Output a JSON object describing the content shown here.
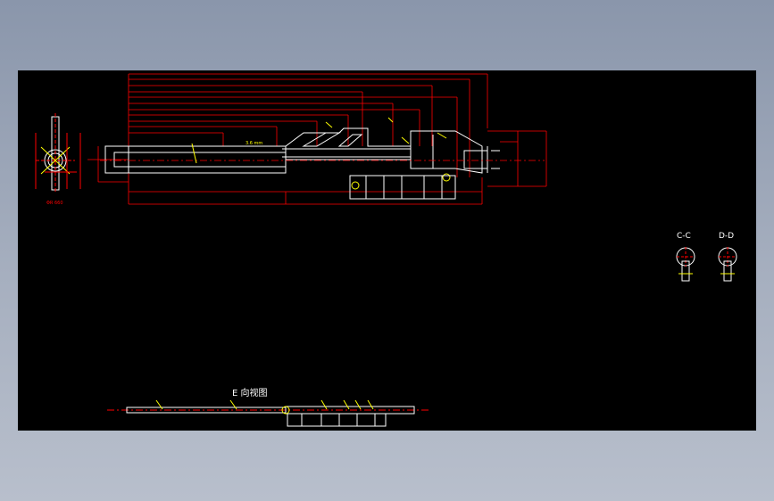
{
  "drawing": {
    "main_dimension": "3.6 mm",
    "section_c": "C-C",
    "section_d": "D-D",
    "view_e": "E 向视图",
    "left_ref": "ΦR 660"
  },
  "colors": {
    "background": "#000000",
    "outline": "#ffffff",
    "dimension": "#ff0000",
    "annotation": "#ffff00",
    "frame": "#8a96ab"
  }
}
